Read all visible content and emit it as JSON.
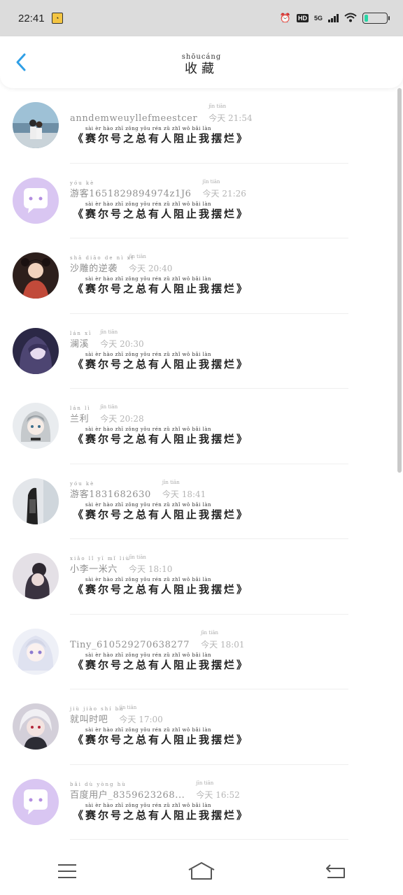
{
  "status_bar": {
    "time": "22:41",
    "hd": "HD",
    "network": "5G"
  },
  "header": {
    "title_pinyin": "shōucáng",
    "title": "收藏"
  },
  "book_title_pinyin": "sài   èr   hào  zhī zǒng yǒu rén   zǔ    zhǐ   wǒ   bǎi   làn",
  "items": [
    {
      "name": "anndemweuyllefmeestcer",
      "name_pinyin": "",
      "time_pinyin": "jīn tiān",
      "time": "今天 21:54",
      "book": "《赛尔号之总有人阻止我摆烂》",
      "avatar": "photo-couple"
    },
    {
      "name": "游客1651829894974z1J6",
      "name_pinyin": "yóu kè",
      "time_pinyin": "jīn tiān",
      "time": "今天 21:26",
      "book": "《赛尔号之总有人阻止我摆烂》",
      "avatar": "default-chat"
    },
    {
      "name": "沙雕的逆袭",
      "name_pinyin": "shā diāo de  nì  xí",
      "time_pinyin": "jīn tiān",
      "time": "今天 20:40",
      "book": "《赛尔号之总有人阻止我摆烂》",
      "avatar": "anime-dark-red"
    },
    {
      "name": "澜溪",
      "name_pinyin": "lán  xī",
      "time_pinyin": "jīn tiān",
      "time": "今天 20:30",
      "book": "《赛尔号之总有人阻止我摆烂》",
      "avatar": "anime-purple"
    },
    {
      "name": "兰利",
      "name_pinyin": "lán  lì",
      "time_pinyin": "jīn tiān",
      "time": "今天 20:28",
      "book": "《赛尔号之总有人阻止我摆烂》",
      "avatar": "anime-silver"
    },
    {
      "name": "游客1831682630",
      "name_pinyin": "yóu kè",
      "time_pinyin": "jīn tiān",
      "time": "今天 18:41",
      "book": "《赛尔号之总有人阻止我摆烂》",
      "avatar": "photo-dark-figure"
    },
    {
      "name": "小李一米六",
      "name_pinyin": "xiǎo  lǐ   yī  mǐ  liù",
      "time_pinyin": "jīn tiān",
      "time": "今天 18:10",
      "book": "《赛尔号之总有人阻止我摆烂》",
      "avatar": "photo-girl"
    },
    {
      "name": "Tiny_610529270638277",
      "name_pinyin": "",
      "time_pinyin": "jīn tiān",
      "time": "今天 18:01",
      "book": "《赛尔号之总有人阻止我摆烂》",
      "avatar": "anime-light"
    },
    {
      "name": "就叫时吧",
      "name_pinyin": "jiù jiào shí  ba",
      "time_pinyin": "jīn tiān",
      "time": "今天 17:00",
      "book": "《赛尔号之总有人阻止我摆烂》",
      "avatar": "anime-white-hair"
    },
    {
      "name": "百度用户_8359623268...",
      "name_pinyin": "bǎi  dù yòng hù",
      "time_pinyin": "jīn tiān",
      "time": "今天 16:52",
      "book": "《赛尔号之总有人阻止我摆烂》",
      "avatar": "default-chat"
    }
  ],
  "colors": {
    "accent": "#2f9fe6",
    "default_avatar": "#d9c6f2",
    "battery": "#27d6a6"
  }
}
